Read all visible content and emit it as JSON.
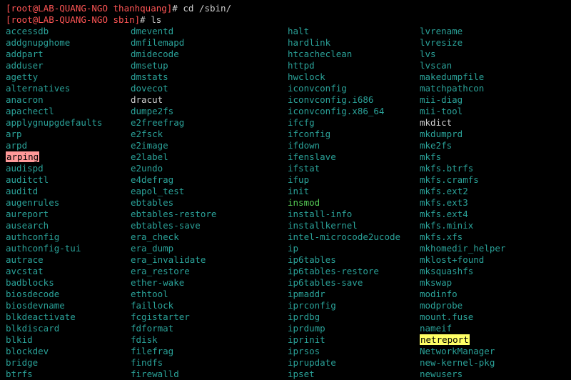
{
  "prompt1": {
    "user": "[root@LAB-QUANG-NGO thanhquang]",
    "hash": "# ",
    "cmd": "cd /sbin/"
  },
  "prompt2": {
    "user": "[root@LAB-QUANG-NGO sbin]",
    "hash": "# ",
    "cmd": "ls"
  },
  "cols": {
    "c0": [
      {
        "t": "accessdb",
        "s": "c-cyan"
      },
      {
        "t": "addgnupghome",
        "s": "c-cyan"
      },
      {
        "t": "addpart",
        "s": "c-cyan"
      },
      {
        "t": "adduser",
        "s": "c-cyan"
      },
      {
        "t": "agetty",
        "s": "c-cyan"
      },
      {
        "t": "alternatives",
        "s": "c-cyan"
      },
      {
        "t": "anacron",
        "s": "c-cyan"
      },
      {
        "t": "apachectl",
        "s": "c-cyan"
      },
      {
        "t": "applygnupgdefaults",
        "s": "c-cyan"
      },
      {
        "t": "arp",
        "s": "c-cyan"
      },
      {
        "t": "arpd",
        "s": "c-cyan"
      },
      {
        "t": "arping",
        "s": "c-hi-red"
      },
      {
        "t": "audispd",
        "s": "c-cyan"
      },
      {
        "t": "auditctl",
        "s": "c-cyan"
      },
      {
        "t": "auditd",
        "s": "c-cyan"
      },
      {
        "t": "augenrules",
        "s": "c-cyan"
      },
      {
        "t": "aureport",
        "s": "c-cyan"
      },
      {
        "t": "ausearch",
        "s": "c-cyan"
      },
      {
        "t": "authconfig",
        "s": "c-cyan"
      },
      {
        "t": "authconfig-tui",
        "s": "c-cyan"
      },
      {
        "t": "autrace",
        "s": "c-cyan"
      },
      {
        "t": "avcstat",
        "s": "c-cyan"
      },
      {
        "t": "badblocks",
        "s": "c-cyan"
      },
      {
        "t": "biosdecode",
        "s": "c-cyan"
      },
      {
        "t": "biosdevname",
        "s": "c-cyan"
      },
      {
        "t": "blkdeactivate",
        "s": "c-cyan"
      },
      {
        "t": "blkdiscard",
        "s": "c-cyan"
      },
      {
        "t": "blkid",
        "s": "c-cyan"
      },
      {
        "t": "blockdev",
        "s": "c-cyan"
      },
      {
        "t": "bridge",
        "s": "c-cyan"
      },
      {
        "t": "btrfs",
        "s": "c-cyan"
      }
    ],
    "c1": [
      {
        "t": "dmeventd",
        "s": "c-cyan"
      },
      {
        "t": "dmfilemapd",
        "s": "c-cyan"
      },
      {
        "t": "dmidecode",
        "s": "c-cyan"
      },
      {
        "t": "dmsetup",
        "s": "c-cyan"
      },
      {
        "t": "dmstats",
        "s": "c-cyan"
      },
      {
        "t": "dovecot",
        "s": "c-cyan"
      },
      {
        "t": "dracut",
        "s": "c-white"
      },
      {
        "t": "dumpe2fs",
        "s": "c-cyan"
      },
      {
        "t": "e2freefrag",
        "s": "c-cyan"
      },
      {
        "t": "e2fsck",
        "s": "c-cyan"
      },
      {
        "t": "e2image",
        "s": "c-cyan"
      },
      {
        "t": "e2label",
        "s": "c-cyan"
      },
      {
        "t": "e2undo",
        "s": "c-cyan"
      },
      {
        "t": "e4defrag",
        "s": "c-cyan"
      },
      {
        "t": "eapol_test",
        "s": "c-cyan"
      },
      {
        "t": "ebtables",
        "s": "c-cyan"
      },
      {
        "t": "ebtables-restore",
        "s": "c-cyan"
      },
      {
        "t": "ebtables-save",
        "s": "c-cyan"
      },
      {
        "t": "era_check",
        "s": "c-cyan"
      },
      {
        "t": "era_dump",
        "s": "c-cyan"
      },
      {
        "t": "era_invalidate",
        "s": "c-cyan"
      },
      {
        "t": "era_restore",
        "s": "c-cyan"
      },
      {
        "t": "ether-wake",
        "s": "c-cyan"
      },
      {
        "t": "ethtool",
        "s": "c-cyan"
      },
      {
        "t": "faillock",
        "s": "c-cyan"
      },
      {
        "t": "fcgistarter",
        "s": "c-cyan"
      },
      {
        "t": "fdformat",
        "s": "c-cyan"
      },
      {
        "t": "fdisk",
        "s": "c-cyan"
      },
      {
        "t": "filefrag",
        "s": "c-cyan"
      },
      {
        "t": "findfs",
        "s": "c-cyan"
      },
      {
        "t": "firewalld",
        "s": "c-cyan"
      }
    ],
    "c2": [
      {
        "t": "halt",
        "s": "c-cyan"
      },
      {
        "t": "hardlink",
        "s": "c-cyan"
      },
      {
        "t": "htcacheclean",
        "s": "c-cyan"
      },
      {
        "t": "httpd",
        "s": "c-cyan"
      },
      {
        "t": "hwclock",
        "s": "c-cyan"
      },
      {
        "t": "iconvconfig",
        "s": "c-cyan"
      },
      {
        "t": "iconvconfig.i686",
        "s": "c-cyan"
      },
      {
        "t": "iconvconfig.x86_64",
        "s": "c-cyan"
      },
      {
        "t": "ifcfg",
        "s": "c-cyan"
      },
      {
        "t": "ifconfig",
        "s": "c-cyan"
      },
      {
        "t": "ifdown",
        "s": "c-cyan"
      },
      {
        "t": "ifenslave",
        "s": "c-cyan"
      },
      {
        "t": "ifstat",
        "s": "c-cyan"
      },
      {
        "t": "ifup",
        "s": "c-cyan"
      },
      {
        "t": "init",
        "s": "c-cyan"
      },
      {
        "t": "insmod",
        "s": "c-green"
      },
      {
        "t": "install-info",
        "s": "c-cyan"
      },
      {
        "t": "installkernel",
        "s": "c-cyan"
      },
      {
        "t": "intel-microcode2ucode",
        "s": "c-cyan"
      },
      {
        "t": "ip",
        "s": "c-cyan"
      },
      {
        "t": "ip6tables",
        "s": "c-cyan"
      },
      {
        "t": "ip6tables-restore",
        "s": "c-cyan"
      },
      {
        "t": "ip6tables-save",
        "s": "c-cyan"
      },
      {
        "t": "ipmaddr",
        "s": "c-cyan"
      },
      {
        "t": "iprconfig",
        "s": "c-cyan"
      },
      {
        "t": "iprdbg",
        "s": "c-cyan"
      },
      {
        "t": "iprdump",
        "s": "c-cyan"
      },
      {
        "t": "iprinit",
        "s": "c-cyan"
      },
      {
        "t": "iprsos",
        "s": "c-cyan"
      },
      {
        "t": "iprupdate",
        "s": "c-cyan"
      },
      {
        "t": "ipset",
        "s": "c-cyan"
      }
    ],
    "c3": [
      {
        "t": "lvrename",
        "s": "c-cyan"
      },
      {
        "t": "lvresize",
        "s": "c-cyan"
      },
      {
        "t": "lvs",
        "s": "c-cyan"
      },
      {
        "t": "lvscan",
        "s": "c-cyan"
      },
      {
        "t": "makedumpfile",
        "s": "c-cyan"
      },
      {
        "t": "matchpathcon",
        "s": "c-cyan"
      },
      {
        "t": "mii-diag",
        "s": "c-cyan"
      },
      {
        "t": "mii-tool",
        "s": "c-cyan"
      },
      {
        "t": "mkdict",
        "s": "c-white"
      },
      {
        "t": "mkdumprd",
        "s": "c-cyan"
      },
      {
        "t": "mke2fs",
        "s": "c-cyan"
      },
      {
        "t": "mkfs",
        "s": "c-cyan"
      },
      {
        "t": "mkfs.btrfs",
        "s": "c-cyan"
      },
      {
        "t": "mkfs.cramfs",
        "s": "c-cyan"
      },
      {
        "t": "mkfs.ext2",
        "s": "c-cyan"
      },
      {
        "t": "mkfs.ext3",
        "s": "c-cyan"
      },
      {
        "t": "mkfs.ext4",
        "s": "c-cyan"
      },
      {
        "t": "mkfs.minix",
        "s": "c-cyan"
      },
      {
        "t": "mkfs.xfs",
        "s": "c-cyan"
      },
      {
        "t": "mkhomedir_helper",
        "s": "c-cyan"
      },
      {
        "t": "mklost+found",
        "s": "c-cyan"
      },
      {
        "t": "mksquashfs",
        "s": "c-cyan"
      },
      {
        "t": "mkswap",
        "s": "c-cyan"
      },
      {
        "t": "modinfo",
        "s": "c-cyan"
      },
      {
        "t": "modprobe",
        "s": "c-cyan"
      },
      {
        "t": "mount.fuse",
        "s": "c-cyan"
      },
      {
        "t": "nameif",
        "s": "c-cyan"
      },
      {
        "t": "netreport",
        "s": "c-hi-yel"
      },
      {
        "t": "NetworkManager",
        "s": "c-cyan"
      },
      {
        "t": "new-kernel-pkg",
        "s": "c-cyan"
      },
      {
        "t": "newusers",
        "s": "c-cyan"
      }
    ]
  }
}
